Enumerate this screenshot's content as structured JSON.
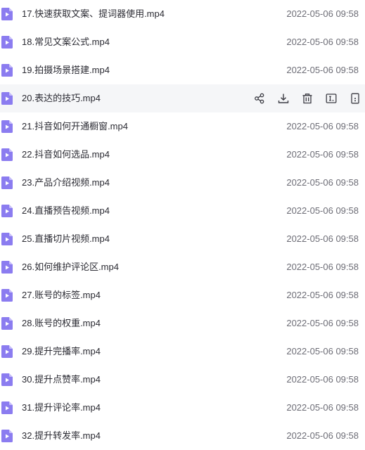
{
  "colors": {
    "icon_purple": "#8b7cf0",
    "icon_fold": "#c6bdfa",
    "text": "#2b2b33",
    "date": "#6d6d76",
    "hover_bg": "#f5f6f8"
  },
  "hover_actions": [
    "share-icon",
    "download-icon",
    "delete-icon",
    "rename-icon",
    "more-icon"
  ],
  "files": [
    {
      "name": "17.快速获取文案、提词器使用.mp4",
      "date": "2022-05-06 09:58",
      "hovered": false
    },
    {
      "name": "18.常见文案公式.mp4",
      "date": "2022-05-06 09:58",
      "hovered": false
    },
    {
      "name": "19.拍摄场景搭建.mp4",
      "date": "2022-05-06 09:58",
      "hovered": false
    },
    {
      "name": "20.表达的技巧.mp4",
      "date": "",
      "hovered": true
    },
    {
      "name": "21.抖音如何开通橱窗.mp4",
      "date": "2022-05-06 09:58",
      "hovered": false
    },
    {
      "name": "22.抖音如何选品.mp4",
      "date": "2022-05-06 09:58",
      "hovered": false
    },
    {
      "name": "23.产品介绍视频.mp4",
      "date": "2022-05-06 09:58",
      "hovered": false
    },
    {
      "name": "24.直播预告视频.mp4",
      "date": "2022-05-06 09:58",
      "hovered": false
    },
    {
      "name": "25.直播切片视频.mp4",
      "date": "2022-05-06 09:58",
      "hovered": false
    },
    {
      "name": "26.如何维护评论区.mp4",
      "date": "2022-05-06 09:58",
      "hovered": false
    },
    {
      "name": "27.账号的标签.mp4",
      "date": "2022-05-06 09:58",
      "hovered": false
    },
    {
      "name": "28.账号的权重.mp4",
      "date": "2022-05-06 09:58",
      "hovered": false
    },
    {
      "name": "29.提升完播率.mp4",
      "date": "2022-05-06 09:58",
      "hovered": false
    },
    {
      "name": "30.提升点赞率.mp4",
      "date": "2022-05-06 09:58",
      "hovered": false
    },
    {
      "name": "31.提升评论率.mp4",
      "date": "2022-05-06 09:58",
      "hovered": false
    },
    {
      "name": "32.提升转发率.mp4",
      "date": "2022-05-06 09:58",
      "hovered": false
    }
  ]
}
